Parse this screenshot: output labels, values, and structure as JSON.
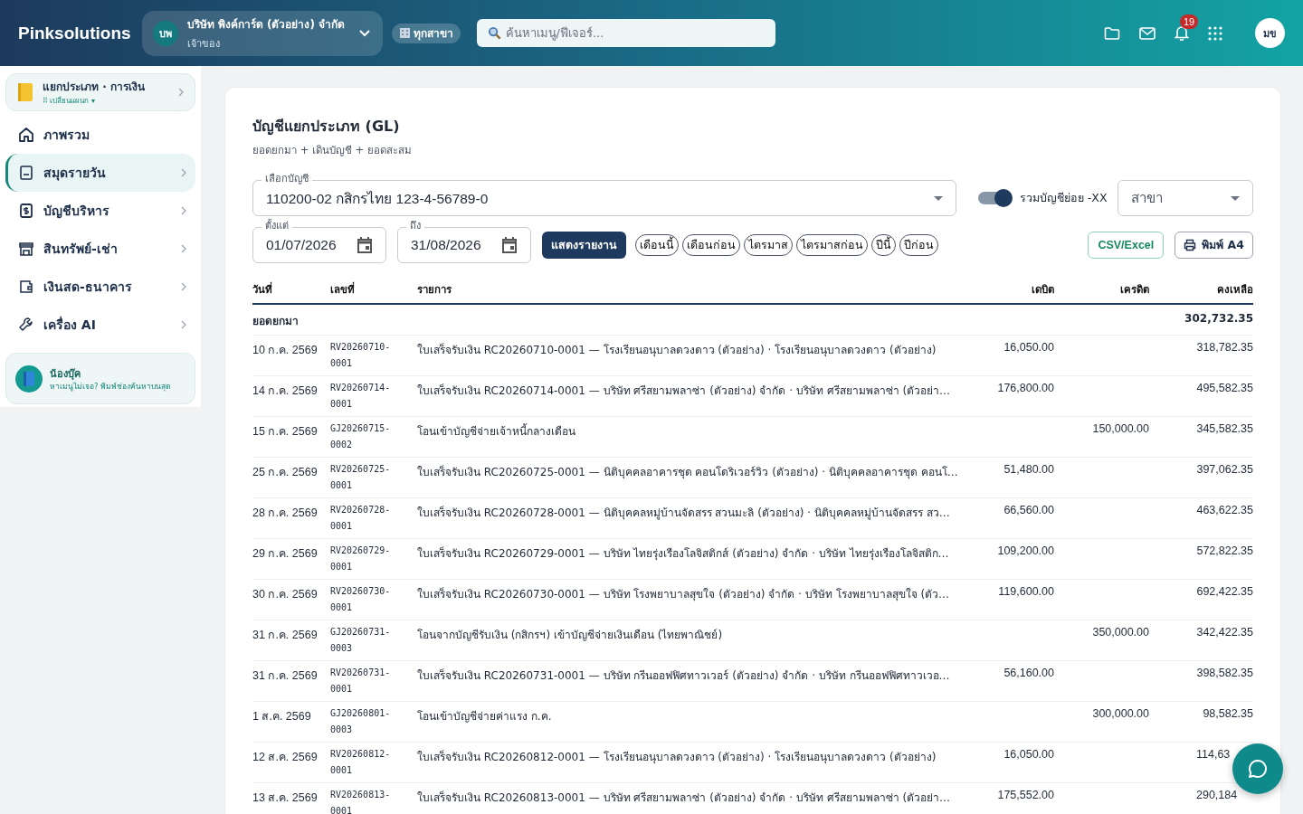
{
  "header": {
    "brand": "Pinksolutions",
    "company": {
      "initials": "บพ",
      "name": "บริษัท พิงค์การ์ด (ตัวอย่าง) จำกัด",
      "role": "เจ้าของ"
    },
    "branch": "ทุกสาขา",
    "search": {
      "placeholder": "ค้นหาเมนู/ฟีเจอร์..."
    },
    "notifications": "19",
    "user": "มข"
  },
  "sidebar": {
    "module": {
      "title": "แยกประเภท · การเงิน",
      "switch": "⠿ เปลี่ยนแผนก ▾"
    },
    "items": [
      {
        "label": "ภาพรวม",
        "selected": false,
        "chevron": false
      },
      {
        "label": "สมุดรายวัน",
        "selected": true,
        "chevron": true
      },
      {
        "label": "บัญชีบริหาร",
        "selected": false,
        "chevron": true
      },
      {
        "label": "สินทรัพย์-เช่า",
        "selected": false,
        "chevron": true
      },
      {
        "label": "เงินสด-ธนาคาร",
        "selected": false,
        "chevron": true
      },
      {
        "label": "เครื่อง AI",
        "selected": false,
        "chevron": true
      }
    ],
    "helper": {
      "name": "น้องบุ๊ค",
      "text": "หาเมนูไม่เจอ? พิมพ์ช่องค้นหาบนสุด"
    }
  },
  "report": {
    "title": "บัญชีแยกประเภท (GL)",
    "subtitle": "ยอดยกมา + เดินบัญชี + ยอดสะสม",
    "account": {
      "label": "เลือกบัญชี",
      "value": "110200-02 กสิกรไทย 123-4-56789-0"
    },
    "include_sub": {
      "label": "รวมบัญชีย่อย -XX",
      "on": true
    },
    "branch": {
      "placeholder": "สาขา"
    },
    "from": {
      "label": "ตั้งแต่",
      "value": "01/07/2026"
    },
    "to": {
      "label": "ถึง",
      "value": "31/08/2026"
    },
    "show_button": "แสดงรายงาน",
    "presets": [
      "เดือนนี้",
      "เดือนก่อน",
      "ไตรมาส",
      "ไตรมาสก่อน",
      "ปีนี้",
      "ปีก่อน"
    ],
    "csv_button": "CSV/Excel",
    "print_button": "พิมพ์ A4"
  },
  "table": {
    "columns": [
      "วันที่",
      "เลขที่",
      "รายการ",
      "เดบิต",
      "เครดิต",
      "คงเหลือ"
    ],
    "opening": {
      "label": "ยอดยกมา",
      "balance": "302,732.35"
    },
    "rows": [
      {
        "date": "10 ก.ค. 2569",
        "doc": "RV20260710-0001",
        "desc": "ใบเสร็จรับเงิน RC20260710-0001 — โรงเรียนอนุบาลดวงดาว (ตัวอย่าง) · โรงเรียนอนุบาลดวงดาว (ตัวอย่าง)",
        "debit": "16,050.00",
        "credit": "",
        "balance": "318,782.35"
      },
      {
        "date": "14 ก.ค. 2569",
        "doc": "RV20260714-0001",
        "desc": "ใบเสร็จรับเงิน RC20260714-0001 — บริษัท ศรีสยามพลาซ่า (ตัวอย่าง) จำกัด · บริษัท ศรีสยามพลาซ่า (ตัวอย่า…",
        "debit": "176,800.00",
        "credit": "",
        "balance": "495,582.35"
      },
      {
        "date": "15 ก.ค. 2569",
        "doc": "GJ20260715-0002",
        "desc": "โอนเข้าบัญชีจ่ายเจ้าหนี้กลางเดือน",
        "debit": "",
        "credit": "150,000.00",
        "balance": "345,582.35"
      },
      {
        "date": "25 ก.ค. 2569",
        "doc": "RV20260725-0001",
        "desc": "ใบเสร็จรับเงิน RC20260725-0001 — นิติบุคคลอาคารชุด คอนโดริเวอร์วิว (ตัวอย่าง) · นิติบุคคลอาคารชุด คอนโ…",
        "debit": "51,480.00",
        "credit": "",
        "balance": "397,062.35"
      },
      {
        "date": "28 ก.ค. 2569",
        "doc": "RV20260728-0001",
        "desc": "ใบเสร็จรับเงิน RC20260728-0001 — นิติบุคคลหมู่บ้านจัดสรร สวนมะลิ (ตัวอย่าง) · นิติบุคคลหมู่บ้านจัดสรร สว…",
        "debit": "66,560.00",
        "credit": "",
        "balance": "463,622.35"
      },
      {
        "date": "29 ก.ค. 2569",
        "doc": "RV20260729-0001",
        "desc": "ใบเสร็จรับเงิน RC20260729-0001 — บริษัท ไทยรุ่งเรืองโลจิสติกส์ (ตัวอย่าง) จำกัด · บริษัท ไทยรุ่งเรืองโลจิสติก…",
        "debit": "109,200.00",
        "credit": "",
        "balance": "572,822.35"
      },
      {
        "date": "30 ก.ค. 2569",
        "doc": "RV20260730-0001",
        "desc": "ใบเสร็จรับเงิน RC20260730-0001 — บริษัท โรงพยาบาลสุขใจ (ตัวอย่าง) จำกัด · บริษัท โรงพยาบาลสุขใจ (ตัว…",
        "debit": "119,600.00",
        "credit": "",
        "balance": "692,422.35"
      },
      {
        "date": "31 ก.ค. 2569",
        "doc": "GJ20260731-0003",
        "desc": "โอนจากบัญชีรับเงิน (กสิกรฯ) เข้าบัญชีจ่ายเงินเดือน (ไทยพาณิชย์)",
        "debit": "",
        "credit": "350,000.00",
        "balance": "342,422.35"
      },
      {
        "date": "31 ก.ค. 2569",
        "doc": "RV20260731-0001",
        "desc": "ใบเสร็จรับเงิน RC20260731-0001 — บริษัท กรีนออฟฟิศทาวเวอร์ (ตัวอย่าง) จำกัด · บริษัท กรีนออฟฟิศทาวเวอ…",
        "debit": "56,160.00",
        "credit": "",
        "balance": "398,582.35"
      },
      {
        "date": "1 ส.ค. 2569",
        "doc": "GJ20260801-0003",
        "desc": "โอนเข้าบัญชีจ่ายค่าแรง ก.ค.",
        "debit": "",
        "credit": "300,000.00",
        "balance": "98,582.35"
      },
      {
        "date": "12 ส.ค. 2569",
        "doc": "RV20260812-0001",
        "desc": "ใบเสร็จรับเงิน RC20260812-0001 — โรงเรียนอนุบาลดวงดาว (ตัวอย่าง) · โรงเรียนอนุบาลดวงดาว (ตัวอย่าง)",
        "debit": "16,050.00",
        "credit": "",
        "balance": "114,63",
        "balance_cut": true
      },
      {
        "date": "13 ส.ค. 2569",
        "doc": "RV20260813-0001",
        "desc": "ใบเสร็จรับเงิน RC20260813-0001 — บริษัท ศรีสยามพลาซ่า (ตัวอย่าง) จำกัด · บริษัท ศรีสยามพลาซ่า (ตัวอย่า…",
        "debit": "175,552.00",
        "credit": "",
        "balance": "290,184",
        "balance_cut": true
      }
    ]
  }
}
